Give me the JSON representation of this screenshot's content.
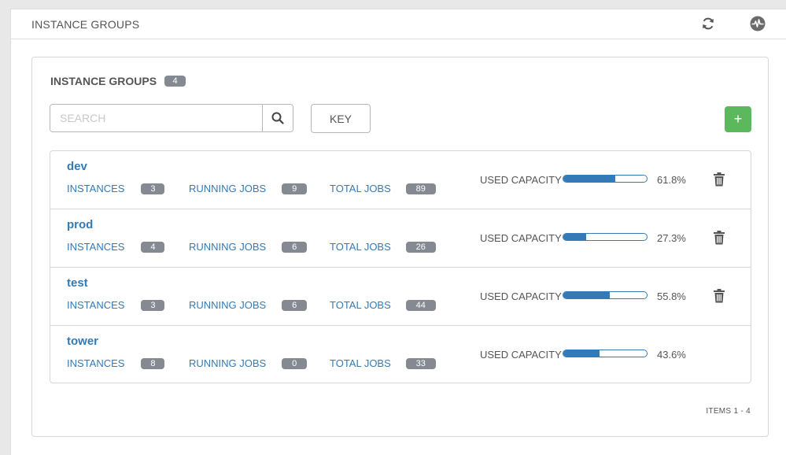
{
  "header": {
    "title": "INSTANCE GROUPS",
    "icons": [
      "refresh-icon",
      "activity-stream-icon"
    ]
  },
  "card": {
    "title": "INSTANCE GROUPS",
    "count": "4",
    "search": {
      "placeholder": "SEARCH",
      "value": ""
    },
    "key_label": "KEY",
    "add_label": "+"
  },
  "labels": {
    "instances": "INSTANCES",
    "running_jobs": "RUNNING JOBS",
    "total_jobs": "TOTAL JOBS",
    "used_capacity": "USED CAPACITY"
  },
  "groups": [
    {
      "name": "dev",
      "instances": "3",
      "running_jobs": "9",
      "total_jobs": "89",
      "capacity_pct": "61.8%",
      "capacity_value": 61.8,
      "deletable": true
    },
    {
      "name": "prod",
      "instances": "4",
      "running_jobs": "6",
      "total_jobs": "26",
      "capacity_pct": "27.3%",
      "capacity_value": 27.3,
      "deletable": true
    },
    {
      "name": "test",
      "instances": "3",
      "running_jobs": "6",
      "total_jobs": "44",
      "capacity_pct": "55.8%",
      "capacity_value": 55.8,
      "deletable": true
    },
    {
      "name": "tower",
      "instances": "8",
      "running_jobs": "0",
      "total_jobs": "33",
      "capacity_pct": "43.6%",
      "capacity_value": 43.6,
      "deletable": false
    }
  ],
  "footer": {
    "items_label": "ITEMS  1 - 4"
  },
  "colors": {
    "link": "#337ab7",
    "badge": "#848992",
    "add_button": "#5cb85c"
  }
}
